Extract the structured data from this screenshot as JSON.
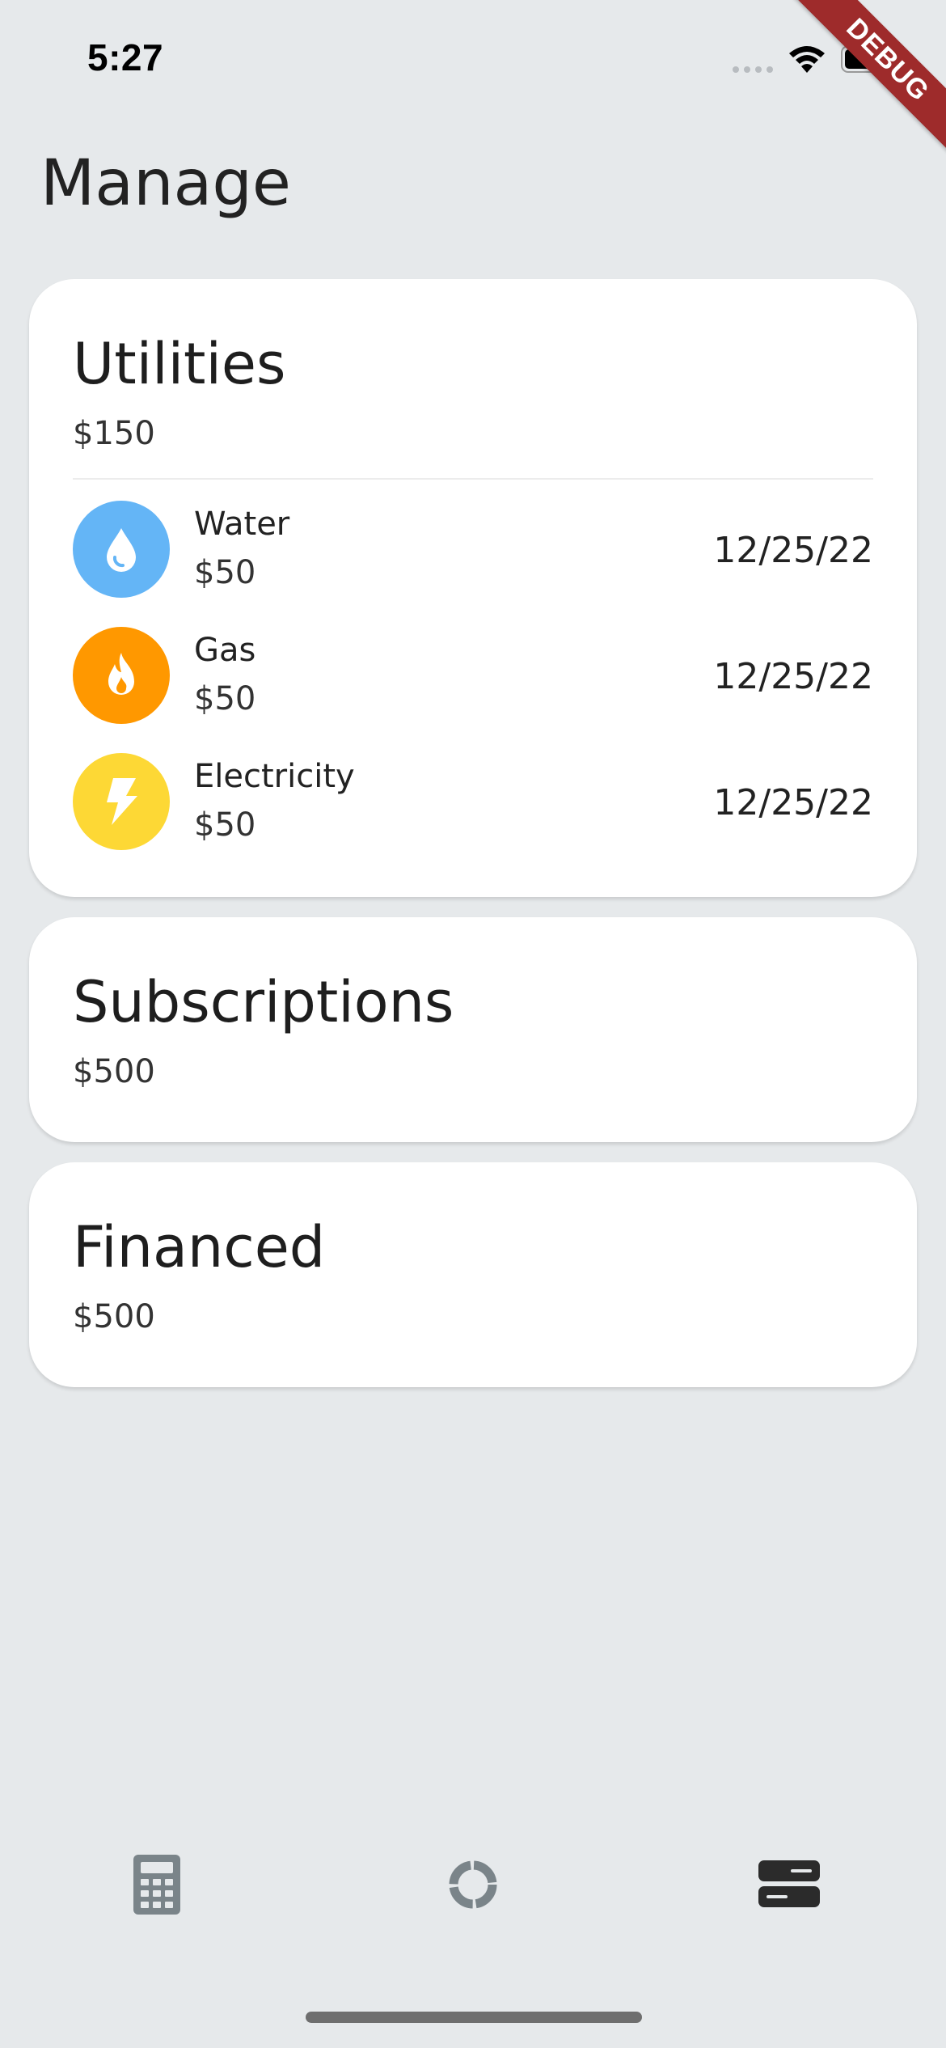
{
  "status_bar": {
    "time": "5:27",
    "debug_label": "DEBUG"
  },
  "page": {
    "title": "Manage"
  },
  "categories": [
    {
      "title": "Utilities",
      "total": "$150",
      "bills": [
        {
          "name": "Water",
          "amount": "$50",
          "date": "12/25/22",
          "icon": "water-drop-icon",
          "color": "#64b5f6"
        },
        {
          "name": "Gas",
          "amount": "$50",
          "date": "12/25/22",
          "icon": "flame-icon",
          "color": "#ff9800"
        },
        {
          "name": "Electricity",
          "amount": "$50",
          "date": "12/25/22",
          "icon": "lightning-bolt-icon",
          "color": "#fdd835"
        }
      ]
    },
    {
      "title": "Subscriptions",
      "total": "$500",
      "bills": []
    },
    {
      "title": "Financed",
      "total": "$500",
      "bills": []
    }
  ],
  "bottom_nav": [
    {
      "icon": "calculator-icon",
      "active": false
    },
    {
      "icon": "donut-chart-icon",
      "active": false
    },
    {
      "icon": "manage-list-icon",
      "active": true
    }
  ],
  "colors": {
    "background": "#e6e9eb",
    "card": "#ffffff",
    "nav_inactive": "#7a8489",
    "nav_active": "#2b2b2b",
    "debug_ribbon": "#9e2b2b"
  }
}
